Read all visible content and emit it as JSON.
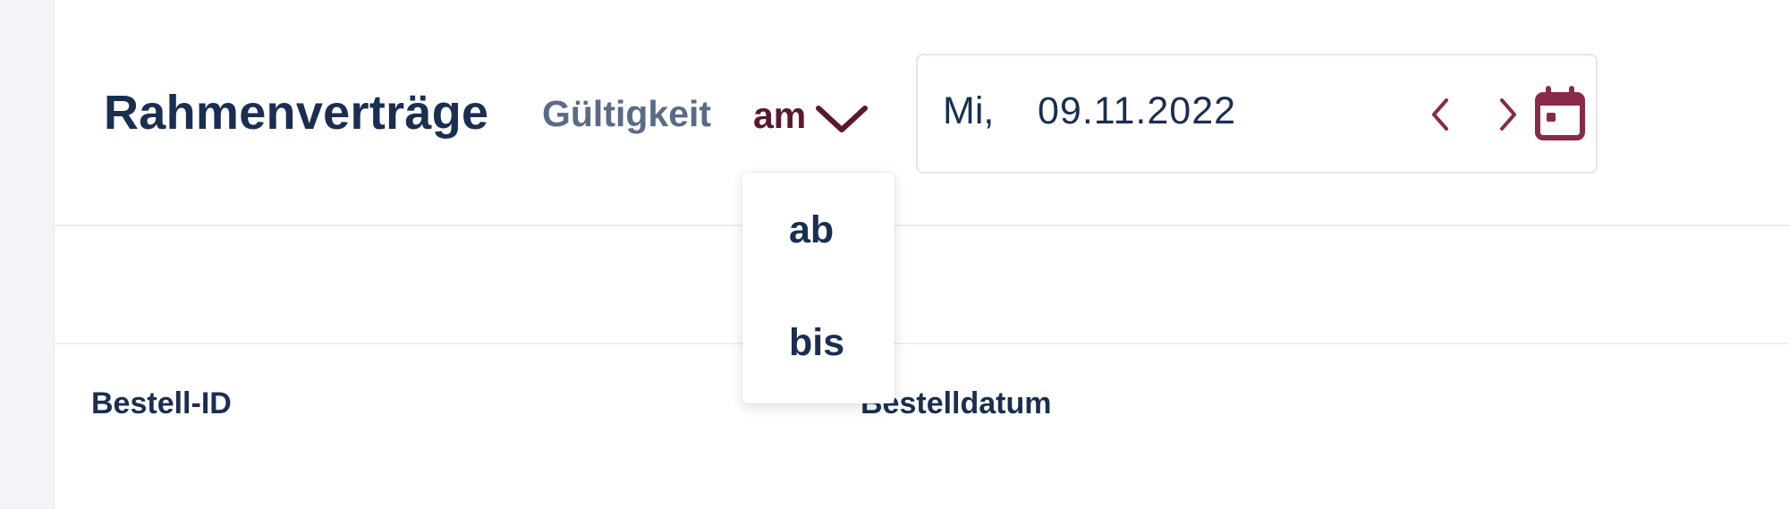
{
  "header": {
    "title": "Rahmenverträge",
    "validity_label": "Gültigkeit",
    "validity_mode": "am"
  },
  "date_picker": {
    "weekday": "Mi,",
    "date": "09.11.2022",
    "icons": [
      "chevron-left-icon",
      "chevron-right-icon",
      "calendar-icon"
    ]
  },
  "dropdown": {
    "options": [
      "ab",
      "bis"
    ]
  },
  "table": {
    "columns": [
      "Bestell-ID",
      "Bestelldatum",
      ""
    ]
  },
  "colors": {
    "title": "#1a2e52",
    "accent": "#8a2a4a",
    "mode_value": "#5a1730",
    "label_muted": "#5a6b86"
  }
}
